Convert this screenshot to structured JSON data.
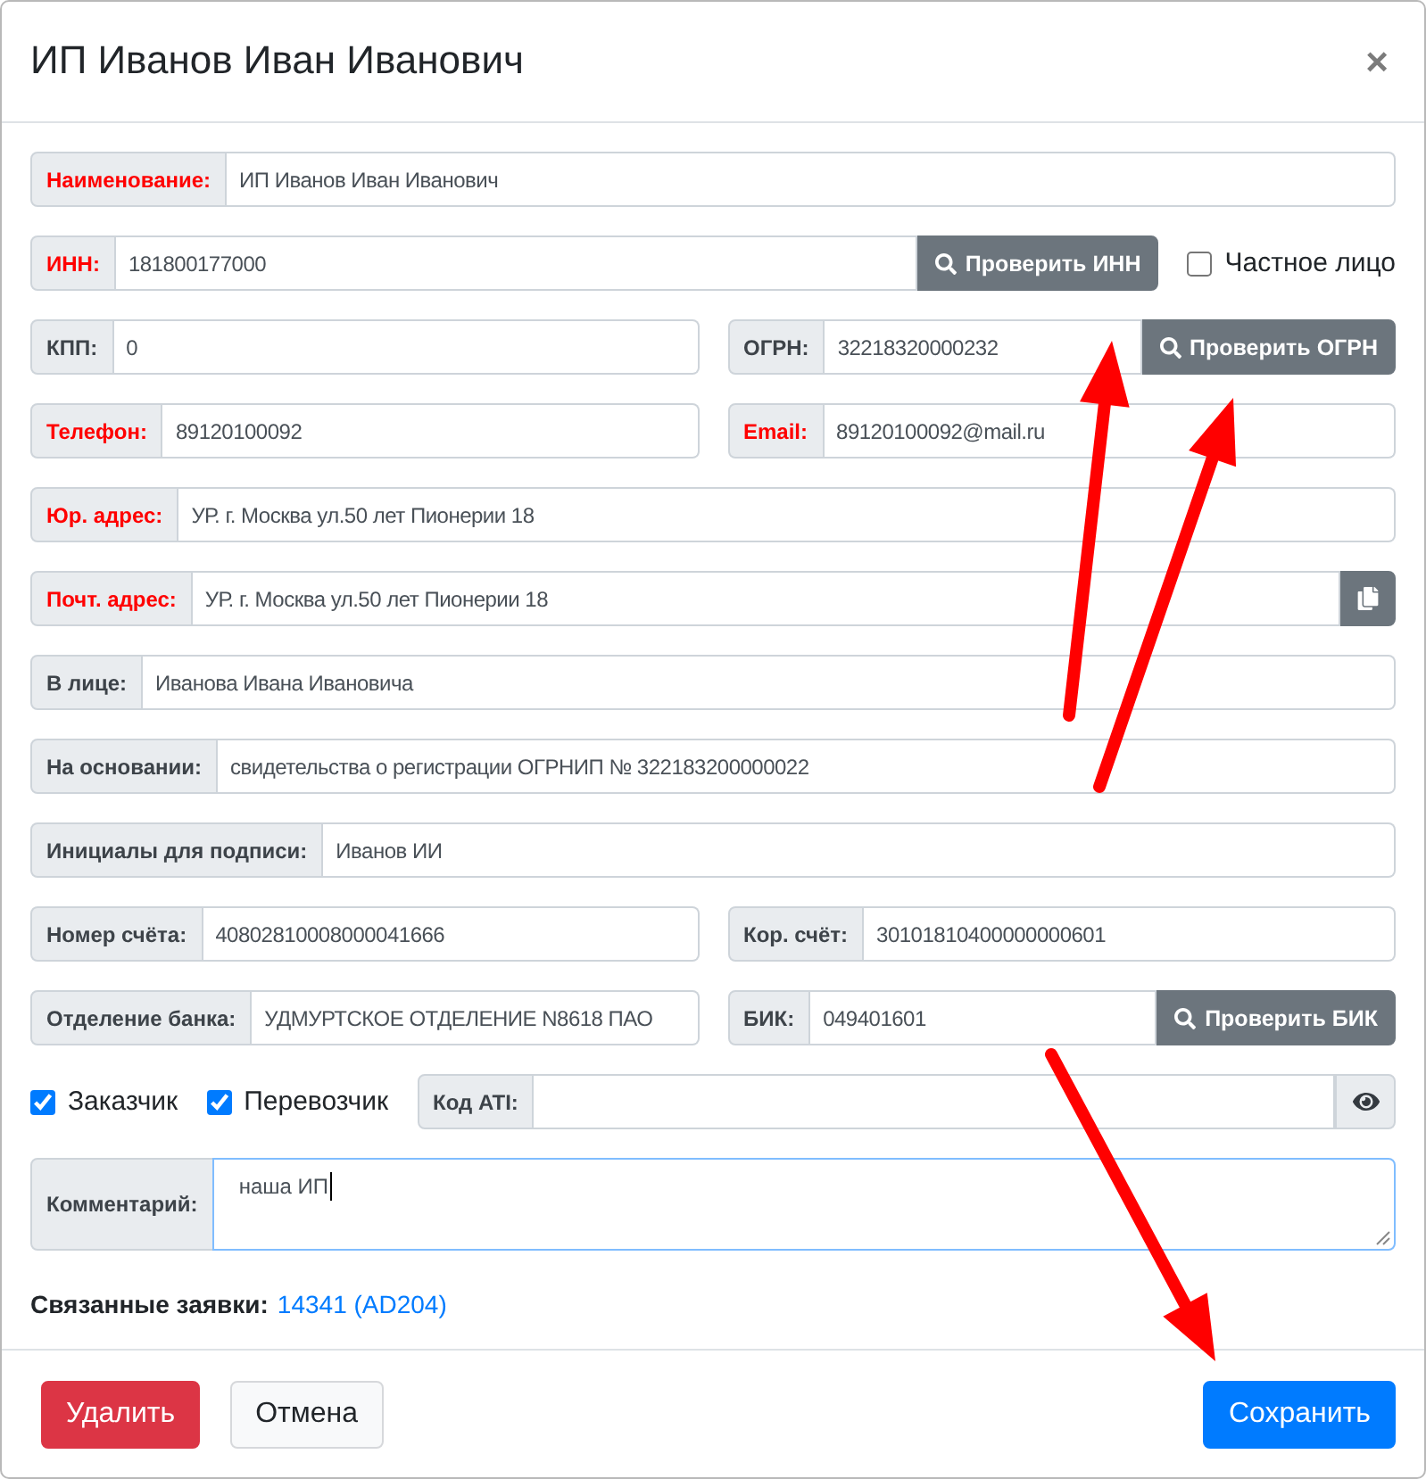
{
  "dialog": {
    "title": "ИП Иванов Иван Иванович",
    "close": "×"
  },
  "rows": [
    {
      "items": [
        {
          "kind": "field",
          "label": "Наименование:",
          "required": true,
          "value": "ИП Иванов Иван Иванович"
        }
      ]
    },
    {
      "items": [
        {
          "kind": "field",
          "label": "ИНН:",
          "required": true,
          "value": "181800177000",
          "addon": {
            "kind": "search",
            "label": "Проверить ИНН"
          }
        },
        {
          "kind": "checkbox",
          "label": "Частное лицо",
          "checked": false
        }
      ]
    },
    {
      "items": [
        {
          "kind": "field",
          "label": "КПП:",
          "required": false,
          "value": "0"
        },
        {
          "kind": "field",
          "label": "ОГРН:",
          "required": false,
          "value": "32218320000232",
          "addon": {
            "kind": "search",
            "label": "Проверить ОГРН"
          }
        }
      ]
    },
    {
      "items": [
        {
          "kind": "field",
          "label": "Телефон:",
          "required": true,
          "value": "89120100092"
        },
        {
          "kind": "field",
          "label": "Email:",
          "required": true,
          "value": "89120100092@mail.ru"
        }
      ]
    },
    {
      "items": [
        {
          "kind": "field",
          "label": "Юр. адрес:",
          "required": true,
          "value": "УР. г. Москва ул.50 лет Пионерии 18"
        }
      ]
    },
    {
      "items": [
        {
          "kind": "field",
          "label": "Почт. адрес:",
          "required": true,
          "value": "УР. г. Москва ул.50 лет Пионерии 18",
          "addon": {
            "kind": "copy"
          }
        }
      ]
    },
    {
      "items": [
        {
          "kind": "field",
          "label": "В лице:",
          "required": false,
          "value": "Иванова Ивана Ивановича"
        }
      ]
    },
    {
      "items": [
        {
          "kind": "field",
          "label": "На основании:",
          "required": false,
          "value": "свидетельства о регистрации ОГРНИП № 322183200000022"
        }
      ]
    },
    {
      "items": [
        {
          "kind": "field",
          "label": "Инициалы для подписи:",
          "required": false,
          "value": "Иванов ИИ"
        }
      ]
    },
    {
      "items": [
        {
          "kind": "field",
          "label": "Номер счёта:",
          "required": false,
          "value": "40802810008000041666"
        },
        {
          "kind": "field",
          "label": "Кор. счёт:",
          "required": false,
          "value": "30101810400000000601"
        }
      ]
    },
    {
      "items": [
        {
          "kind": "field",
          "label": "Отделение банка:",
          "required": false,
          "value": "УДМУРТСКОЕ ОТДЕЛЕНИЕ N8618 ПАО"
        },
        {
          "kind": "field",
          "label": "БИК:",
          "required": false,
          "value": "049401601",
          "addon": {
            "kind": "search",
            "label": "Проверить БИК"
          }
        }
      ]
    },
    {
      "items": [
        {
          "kind": "checkbox",
          "label": "Заказчик",
          "checked": true
        },
        {
          "kind": "checkbox",
          "label": "Перевозчик",
          "checked": true
        },
        {
          "kind": "field",
          "label": "Код ATI:",
          "required": false,
          "addon": {
            "kind": "view"
          }
        }
      ]
    },
    {
      "items": [
        {
          "kind": "textarea",
          "label": "Комментарий:",
          "required": false,
          "value": "наша ИП",
          "focused": true
        }
      ]
    }
  ],
  "linked_orders": {
    "label": "Связанные заявки:",
    "link": "14341 (AD204)"
  },
  "footer_buttons": [
    {
      "kind": "danger",
      "label": "Удалить"
    },
    {
      "kind": "secondary",
      "label": "Отмена"
    },
    {
      "kind": "primary",
      "label": "Сохранить"
    }
  ]
}
